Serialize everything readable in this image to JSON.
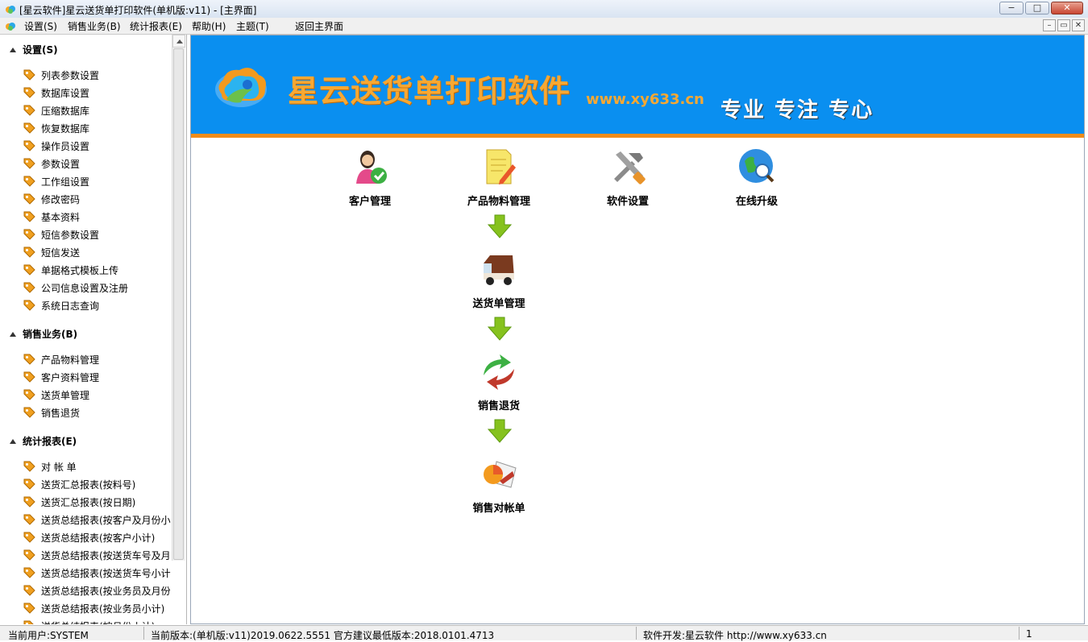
{
  "window": {
    "title": "[星云软件]星云送货单打印软件(单机版:v11) - [主界面]",
    "minimize": "−",
    "maximize": "□",
    "close": "✕"
  },
  "menubar": {
    "items": [
      "设置(S)",
      "销售业务(B)",
      "统计报表(E)",
      "帮助(H)",
      "主题(T)",
      "返回主界面"
    ],
    "mdi": [
      "–",
      "▭",
      "✕"
    ]
  },
  "sidebar": {
    "sections": [
      {
        "title": "设置(S)",
        "items": [
          "列表参数设置",
          "数据库设置",
          "压缩数据库",
          "恢复数据库",
          "操作员设置",
          "参数设置",
          "工作组设置",
          "修改密码",
          "基本资料",
          "短信参数设置",
          "短信发送",
          "单据格式模板上传",
          "公司信息设置及注册",
          "系统日志查询"
        ]
      },
      {
        "title": "销售业务(B)",
        "items": [
          "产品物料管理",
          "客户资料管理",
          "送货单管理",
          "销售退货"
        ]
      },
      {
        "title": "统计报表(E)",
        "items": [
          "对 帐 单",
          "送货汇总报表(按料号)",
          "送货汇总报表(按日期)",
          "送货总结报表(按客户及月份小",
          "送货总结报表(按客户小计)",
          "送货总结报表(按送货车号及月",
          "送货总结报表(按送货车号小计",
          "送货总结报表(按业务员及月份",
          "送货总结报表(按业务员小计)",
          "送货总结报表(按月份小计)"
        ]
      }
    ]
  },
  "banner": {
    "brand": "星云送货单打印软件",
    "url": "www.xy633.cn",
    "slogan": "专业 专注 专心"
  },
  "tiles": {
    "customer": "客户管理",
    "product": "产品物料管理",
    "settings": "软件设置",
    "upgrade": "在线升级",
    "delivery": "送货单管理",
    "returns": "销售退货",
    "statement": "销售对帐单"
  },
  "statusbar": {
    "user": "当前用户:SYSTEM",
    "version": "当前版本:(单机版:v11)2019.0622.5551 官方建议最低版本:2018.0101.4713",
    "developer": "软件开发:星云软件 http://www.xy633.cn",
    "page": "1"
  },
  "colors": {
    "banner_bg": "#0a8ff0",
    "banner_stripe": "#f08c1a",
    "brand_text": "#f7a833"
  }
}
